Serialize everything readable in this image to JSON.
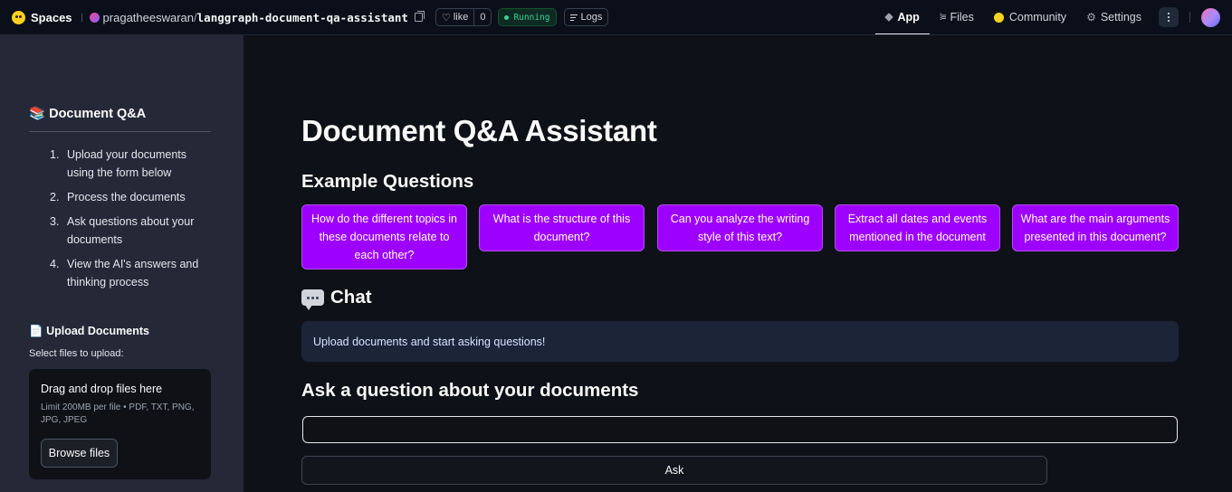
{
  "topbar": {
    "brand": "Spaces",
    "owner": "pragatheeswaran",
    "slash": "/",
    "repo": "langgraph-document-qa-assistant",
    "like_label": "like",
    "like_count": "0",
    "status": "Running",
    "logs_label": "Logs",
    "nav": [
      {
        "label": "App",
        "icon": "cube-icon",
        "active": true
      },
      {
        "label": "Files",
        "icon": "files-icon"
      },
      {
        "label": "Community",
        "icon": "community-icon"
      },
      {
        "label": "Settings",
        "icon": "gear-icon"
      }
    ]
  },
  "sidebar": {
    "title_emoji": "📚",
    "title": "Document Q&A",
    "steps": [
      {
        "num": "1.",
        "text": "Upload your documents using the form below"
      },
      {
        "num": "2.",
        "text": "Process the documents"
      },
      {
        "num": "3.",
        "text": "Ask questions about your documents"
      },
      {
        "num": "4.",
        "text": "View the AI's answers and thinking process"
      }
    ],
    "upload_emoji": "📄",
    "upload_title": "Upload Documents",
    "select_label": "Select files to upload:",
    "dropzone": {
      "title": "Drag and drop files here",
      "limit": "Limit 200MB per file • PDF, TXT, PNG, JPG, JPEG",
      "browse_label": "Browse files"
    }
  },
  "main": {
    "title": "Document Q&A Assistant",
    "examples_heading": "Example Questions",
    "example_questions": [
      "How do the different topics in these documents relate to each other?",
      "What is the structure of this document?",
      "Can you analyze the writing style of this text?",
      "Extract all dates and events mentioned in the document",
      "What are the main arguments presented in this document?"
    ],
    "chat_heading": "Chat",
    "info_message": "Upload documents and start asking questions!",
    "ask_heading": "Ask a question about your documents",
    "question_value": "",
    "ask_button": "Ask"
  },
  "colors": {
    "accent_button": "#9d00ff",
    "background": "#0e1117",
    "sidebar": "#252837",
    "info_bg": "#1c2438",
    "running_green": "#34d399"
  }
}
